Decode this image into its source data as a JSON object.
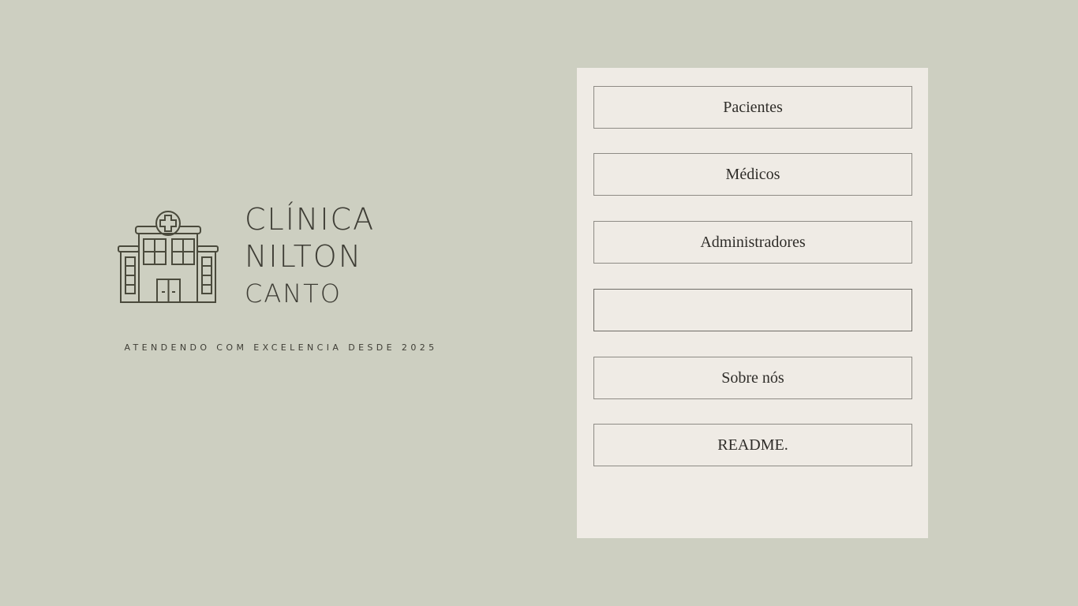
{
  "brand": {
    "line1": "CLÍNICA",
    "line2": "NILTON",
    "line3": "CANTO",
    "tagline": "ATENDENDO COM EXCELENCIA DESDE 2025",
    "icon": "hospital-building-icon"
  },
  "menu": {
    "items": [
      {
        "label": "Pacientes"
      },
      {
        "label": "Médicos"
      },
      {
        "label": "Administradores"
      },
      {
        "label": ""
      },
      {
        "label": "Sobre nós"
      },
      {
        "label": "README."
      }
    ]
  },
  "colors": {
    "background": "#cdcfc1",
    "panel": "#efebe5",
    "text": "#3e3d35",
    "border": "#8e8b85"
  }
}
